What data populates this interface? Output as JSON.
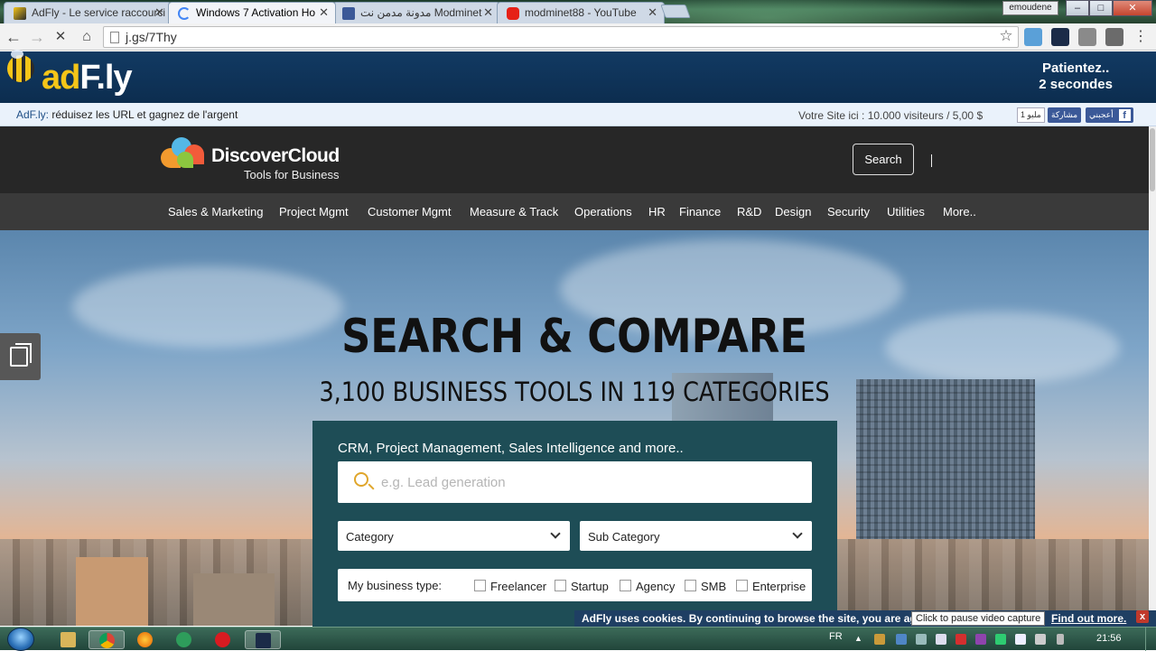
{
  "browser": {
    "tabs": [
      {
        "title": "AdFly - Le service raccourci",
        "icon": "adfly-favicon",
        "active": false
      },
      {
        "title": "Windows 7 Activation Ho",
        "icon": "loading-spinner-icon",
        "active": true
      },
      {
        "title": "مدونة مدمن نت Modminet",
        "icon": "facebook-favicon",
        "active": false
      },
      {
        "title": "modminet88 - YouTube",
        "icon": "youtube-favicon",
        "active": false
      }
    ],
    "user": "emoudene",
    "url": "j.gs/7Thy",
    "window_controls": {
      "minimize": "–",
      "maximize": "□",
      "close": "✕"
    }
  },
  "adfly": {
    "logo_ad": "ad",
    "logo_fly": "F.ly",
    "wait_line1": "Patientez..",
    "wait_line2": "2 secondes",
    "info_brand": "AdF.ly:",
    "info_text": " réduisez les URL et gagnez de l'argent",
    "site_offer": "Votre Site ici : 10.000 visiteurs / 5,00 $",
    "fb_count": "1 مليو",
    "fb_share": "مشاركة",
    "fb_like": "أعجبني"
  },
  "site": {
    "brand": "DiscoverCloud",
    "tagline": "Tools for Business",
    "search_label": "Search",
    "nav": [
      "Sales & Marketing",
      "Project Mgmt",
      "Customer Mgmt",
      "Measure & Track",
      "Operations",
      "HR",
      "Finance",
      "R&D",
      "Design",
      "Security",
      "Utilities",
      "More.."
    ],
    "hero_title": "SEARCH & COMPARE",
    "hero_subtitle": "3,100 BUSINESS TOOLS IN 119 CATEGORIES",
    "panel_caption": "CRM, Project Management, Sales Intelligence and more..",
    "search_placeholder": "e.g. Lead generation",
    "category_label": "Category",
    "subcategory_label": "Sub Category",
    "business_type_label": "My business type:",
    "business_types": [
      "Freelancer",
      "Startup",
      "Agency",
      "SMB",
      "Enterprise"
    ]
  },
  "cookie_bar": {
    "message": "AdFly uses cookies. By continuing to browse the site, you are agr",
    "link": "Find out more.",
    "close": "x"
  },
  "tooltip": "Click to pause video capture",
  "taskbar": {
    "language": "FR",
    "clock": "21:56"
  },
  "colors": {
    "adfly_bar": "#0c2d4f",
    "site_header": "#272727",
    "nav_bar": "#3a3a3a",
    "search_panel": "#1e4d56",
    "accent_search_icon": "#e0a62b"
  }
}
